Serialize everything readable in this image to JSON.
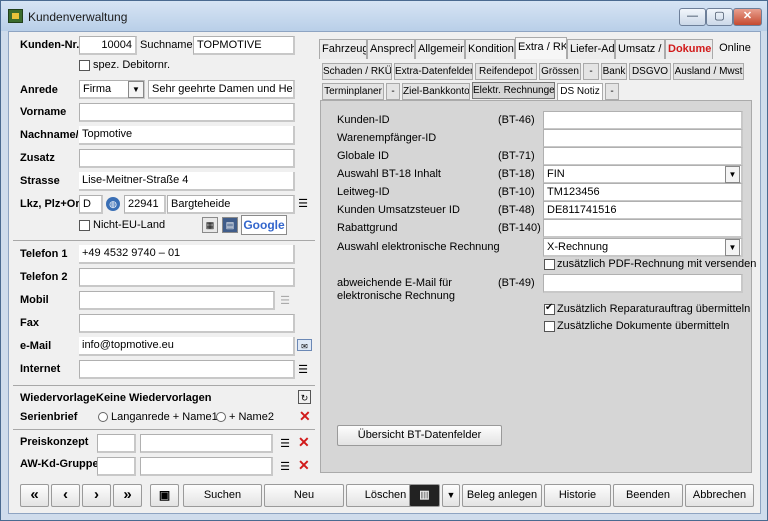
{
  "window": {
    "title": "Kundenverwaltung",
    "min": "—",
    "max": "▢",
    "close": "✕"
  },
  "form": {
    "kunden_nr_label": "Kunden-Nr.",
    "kunden_nr": "10004",
    "suchname_label": "Suchname",
    "suchname": "TOPMOTIVE",
    "spez_debitornr": "spez. Debitornr.",
    "anrede_label": "Anrede",
    "anrede": "Firma",
    "briefanrede": "Sehr geehrte Damen und Herre",
    "vorname_label": "Vorname",
    "vorname": "",
    "nachname_label": "Nachname/F",
    "nachname": "Topmotive",
    "zusatz_label": "Zusatz",
    "zusatz": "",
    "strasse_label": "Strasse",
    "strasse": "Lise-Meitner-Straße 4",
    "lkz_label": "Lkz, Plz+Ort",
    "lkz": "D",
    "plz": "22941",
    "ort": "Bargteheide",
    "nicht_eu": "Nicht-EU-Land",
    "google": "Google",
    "telefon1_label": "Telefon 1",
    "telefon1": "+49 4532 9740 – 01",
    "telefon2_label": "Telefon 2",
    "telefon2": "",
    "mobil_label": "Mobil",
    "mobil": "",
    "fax_label": "Fax",
    "fax": "",
    "email_label": "e-Mail",
    "email": "info@topmotive.eu",
    "internet_label": "Internet",
    "internet": "",
    "wiedervorlage_label": "Wiedervorlage",
    "wiedervorlage": "Keine Wiedervorlagen",
    "serienbrief_label": "Serienbrief",
    "serienbrief_opt1": "Langanrede + Name1",
    "serienbrief_opt2": "+ Name2",
    "preiskonzept_label": "Preiskonzept",
    "awkd_label": "AW-Kd-Gruppe"
  },
  "tabs": {
    "row1": [
      "Fahrzeuge",
      "Ansprech",
      "Allgemein",
      "Konditione",
      "Extra / RK",
      "Liefer-Adr",
      "Umsatz / I",
      "Dokumen",
      "Online"
    ],
    "row2": [
      "Schaden / RKÜ",
      "Extra-Datenfelder",
      "Reifendepot",
      "Grössen",
      "-",
      "Bank",
      "DSGVO",
      "Ausland / Mwst"
    ],
    "row3": [
      "Terminplaner",
      "-",
      "Ziel-Bankkonto",
      "Elektr. Rechnungen",
      "DS Notiz",
      "-"
    ]
  },
  "erechnung": {
    "kunden_id": "Kunden-ID",
    "kunden_id_bt": "(BT-46)",
    "kunden_id_val": "",
    "warenempfaenger": "Warenempfänger-ID",
    "warenempfaenger_val": "",
    "globale_id": "Globale ID",
    "globale_id_bt": "(BT-71)",
    "globale_id_val": "",
    "bt18": "Auswahl BT-18 Inhalt",
    "bt18_bt": "(BT-18)",
    "bt18_val": "FIN",
    "leitweg": "Leitweg-ID",
    "leitweg_bt": "(BT-10)",
    "leitweg_val": "TM123456",
    "ust": "Kunden Umsatzsteuer ID",
    "ust_bt": "(BT-48)",
    "ust_val": "DE811741516",
    "rabatt": "Rabattgrund",
    "rabatt_bt": "(BT-140)",
    "rabatt_val": "",
    "auswahl": "Auswahl  elektronische Rechnung",
    "auswahl_val": "X-Rechnung",
    "pdf": "zusätzlich PDF-Rechnung mit versenden",
    "email_abw": "abweichende E-Mail für",
    "email_abw2": "elektronische Rechnung",
    "email_abw_bt": "(BT-49)",
    "email_abw_val": "",
    "reparatur": "Zusätzlich Reparaturauftrag übermitteln",
    "dokumente": "Zusätzliche Dokumente übermitteln",
    "uebersicht": "Übersicht BT-Datenfelder"
  },
  "toolbar": {
    "first": "«",
    "prev": "‹",
    "next": "›",
    "last": "»",
    "suchen": "Suchen",
    "neu": "Neu",
    "loeschen": "Löschen",
    "beleg": "Beleg anlegen",
    "historie": "Historie",
    "beenden": "Beenden",
    "abbrechen": "Abbrechen"
  },
  "colors": {
    "accent_red": "#d11a1a",
    "title_bar": "#c6d8ee"
  }
}
